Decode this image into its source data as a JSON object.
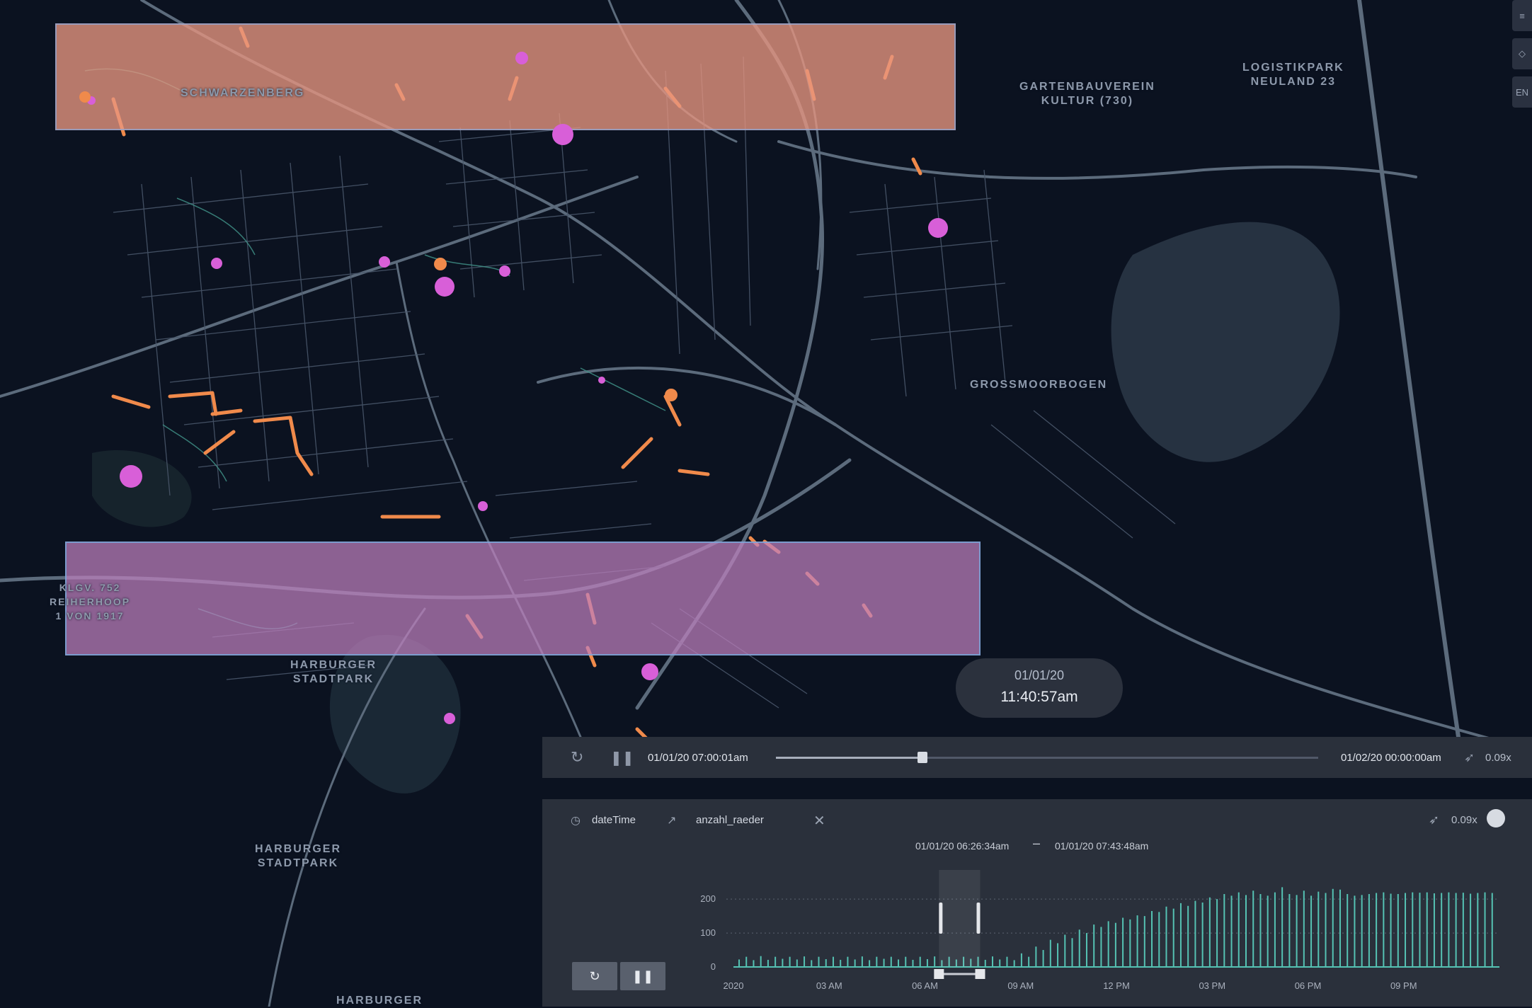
{
  "map": {
    "labels": {
      "schwarzenberg": "SCHWARZENBERG",
      "gartenbauverein": "GARTENBAUVEREIN\nKULTUR (730)",
      "logistikpark": "LOGISTIKPARK\nNEULAND 23",
      "grossmoorbogen": "GROSSMOORBOGEN",
      "klgv": "KLGV. 752\nREIHERHOOP\n1 VON 1917",
      "harburger_stadtpark_1": "HARBURGER\nSTADTPARK",
      "harburger_stadtpark_2": "HARBURGER\nSTADTPARK",
      "harburger_bottom": "HARBURGER"
    },
    "colors": {
      "background": "#0b1220",
      "road": "#5c6b7c",
      "path": "#3f8f86",
      "trip": "#f08a4b",
      "point": "#d85fd8",
      "zone_top": "#e89680",
      "zone_bottom": "#be80be"
    }
  },
  "side_toolbar": {
    "items": [
      "layers-icon",
      "map-style-icon",
      "EN"
    ]
  },
  "time_bubble": {
    "date": "01/01/20",
    "time": "11:40:57am"
  },
  "playback": {
    "start": "01/01/20 07:00:01am",
    "end": "01/02/20 00:00:00am",
    "speed": "0.09x",
    "progress": 0.27
  },
  "filter": {
    "field_label": "dateTime",
    "metric_label": "anzahl_raeder",
    "speed": "0.09x",
    "range_start": "01/01/20 06:26:34am",
    "range_end": "01/01/20 07:43:48am"
  },
  "chart_data": {
    "type": "bar",
    "ylabel": "",
    "xlabel": "",
    "ylim": [
      0,
      240
    ],
    "y_ticks": [
      "200",
      "100",
      "0"
    ],
    "y_tick_values": [
      200,
      100,
      0
    ],
    "x_ticks": [
      "2020",
      "03 AM",
      "06 AM",
      "09 AM",
      "12 PM",
      "03 PM",
      "06 PM",
      "09 PM"
    ],
    "x_tick_hours": [
      0,
      3,
      6,
      9,
      12,
      15,
      18,
      21
    ],
    "x_max_hours": 24,
    "grid": true,
    "selection_hours": [
      6.44,
      7.73
    ],
    "bar_values": [
      22,
      30,
      20,
      32,
      21,
      30,
      24,
      30,
      22,
      31,
      20,
      30,
      23,
      30,
      21,
      30,
      22,
      31,
      20,
      30,
      24,
      30,
      22,
      30,
      21,
      30,
      23,
      31,
      20,
      30,
      22,
      30,
      24,
      30,
      21,
      31,
      22,
      30,
      20,
      40,
      30,
      60,
      50,
      80,
      70,
      95,
      85,
      110,
      100,
      125,
      118,
      135,
      130,
      145,
      140,
      152,
      150,
      165,
      162,
      178,
      172,
      188,
      180,
      195,
      190,
      205,
      200,
      215,
      210,
      220,
      212,
      225,
      215,
      210,
      220,
      235,
      215,
      212,
      225,
      210,
      222,
      218,
      230,
      228,
      215,
      210,
      212,
      215,
      218,
      220,
      216,
      215,
      218,
      220,
      219,
      220,
      217,
      218,
      220,
      218,
      219,
      216,
      218,
      220,
      218
    ]
  }
}
